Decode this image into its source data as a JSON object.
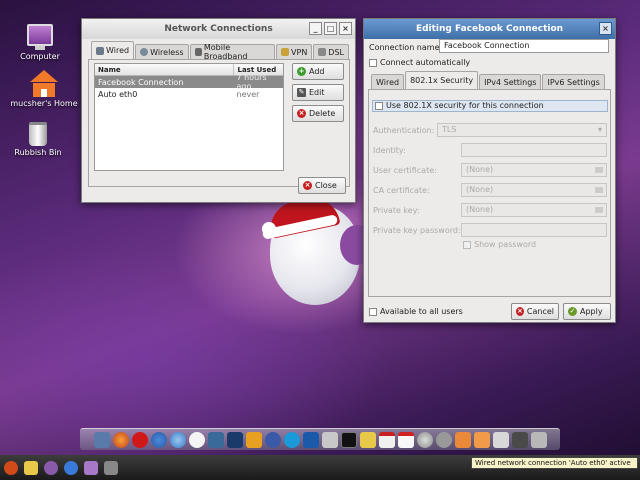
{
  "desktop": {
    "icons": [
      {
        "label": "Computer",
        "icon": "computer-icon"
      },
      {
        "label": "mucsher's Home",
        "icon": "home-folder-icon"
      },
      {
        "label": "Rubbish Bin",
        "icon": "trash-icon"
      }
    ]
  },
  "network_connections": {
    "title": "Network Connections",
    "tabs": [
      "Wired",
      "Wireless",
      "Mobile Broadband",
      "VPN",
      "DSL"
    ],
    "columns": [
      "Name",
      "Last Used"
    ],
    "rows": [
      {
        "name": "Facebook Connection",
        "last_used": "7 hours ago",
        "selected": true
      },
      {
        "name": "Auto eth0",
        "last_used": "never",
        "selected": false
      }
    ],
    "buttons": {
      "add": "Add",
      "edit": "Edit",
      "delete": "Delete",
      "close": "Close"
    }
  },
  "editing": {
    "title": "Editing Facebook Connection",
    "connection_name_label": "Connection name:",
    "connection_name_value": "Facebook Connection",
    "connect_auto_label": "Connect automatically",
    "tabs": [
      "Wired",
      "802.1x Security",
      "IPv4 Settings",
      "IPv6 Settings"
    ],
    "use_8021x_label": "Use 802.1X security for this connection",
    "authentication_label": "Authentication:",
    "authentication_value": "TLS",
    "identity_label": "Identity:",
    "user_cert_label": "User certificate:",
    "user_cert_value": "(None)",
    "ca_cert_label": "CA certificate:",
    "ca_cert_value": "(None)",
    "private_key_label": "Private key:",
    "private_key_value": "(None)",
    "private_key_password_label": "Private key password:",
    "show_password_label": "Show password",
    "available_all_users_label": "Available to all users",
    "cancel_label": "Cancel",
    "apply_label": "Apply"
  },
  "dock": {
    "items": [
      "finder",
      "firefox",
      "opera",
      "chromium",
      "safari",
      "clock",
      "photos",
      "photoshop",
      "vlc",
      "thunderbird",
      "skype",
      "teamviewer",
      "mail",
      "terminal",
      "notes",
      "gmail",
      "ical",
      "itunes",
      "preferences",
      "folder-documents",
      "folder-downloads",
      "folder-music",
      "network",
      "system-monitor"
    ]
  },
  "panel": {
    "tooltip": "Wired network connection 'Auto eth0' active"
  },
  "colors": {
    "active_titlebar": "#3f6fa8",
    "list_selection": "#8a8a8a",
    "wallpaper_purple": "#5a2a7a"
  }
}
